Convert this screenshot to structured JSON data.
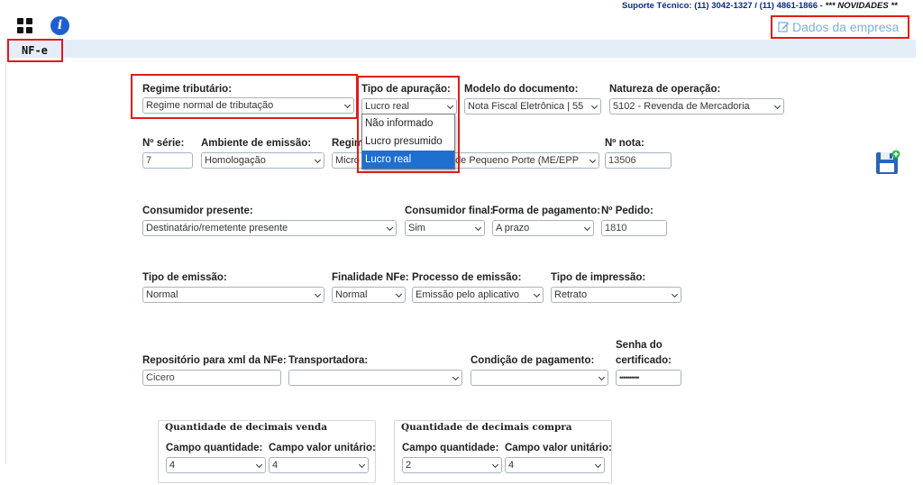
{
  "header": {
    "support_text": "Suporte Técnico: (11) 3042-1327 / (11) 4861-1866 - ",
    "novidades_text": "*** NOVIDADES **",
    "dados_empresa_label": "Dados da empresa",
    "section_title": "NF-e"
  },
  "form": {
    "regime_tributario": {
      "label": "Regime tributário:",
      "value": "Regime normal de tributação"
    },
    "tipo_apuracao": {
      "label": "Tipo de apuração:",
      "value": "Lucro real",
      "options": [
        "Não informado",
        "Lucro presumido",
        "Lucro real"
      ]
    },
    "modelo_documento": {
      "label": "Modelo do documento:",
      "value": "Nota Fiscal Eletrônica | 55"
    },
    "natureza_operacao": {
      "label": "Natureza de operação:",
      "value": "5102 - Revenda de Mercadoria"
    },
    "n_serie": {
      "label": "Nº série:",
      "value": "7"
    },
    "ambiente_emissao": {
      "label": "Ambiente de emissão:",
      "value": "Homologação"
    },
    "regime_label_partial": "Regim",
    "regime_select_partial_left": "Micro",
    "regime_select_partial_right": "a de Pequeno Porte (ME/EPP",
    "n_nota": {
      "label": "Nº nota:",
      "value": "13506"
    },
    "consumidor_presente": {
      "label": "Consumidor presente:",
      "value": "Destinatário/remetente presente"
    },
    "consumidor_final": {
      "label": "Consumidor final:",
      "value": "Sim"
    },
    "forma_pagamento": {
      "label": "Forma de pagamento:",
      "value": "A prazo"
    },
    "n_pedido": {
      "label": "Nº Pedido:",
      "value": "1810"
    },
    "tipo_emissao": {
      "label": "Tipo de emissão:",
      "value": "Normal"
    },
    "finalidade_nfe": {
      "label": "Finalidade NFe:",
      "value": "Normal"
    },
    "processo_emissao": {
      "label": "Processo de emissão:",
      "value": "Emissão pelo aplicativo"
    },
    "tipo_impressao": {
      "label": "Tipo de impressão:",
      "value": "Retrato"
    },
    "repositorio_xml": {
      "label": "Repositório para xml da NFe:",
      "value": "Cicero"
    },
    "transportadora": {
      "label": "Transportadora:",
      "value": ""
    },
    "condicao_pagamento": {
      "label": "Condição de pagamento:",
      "value": ""
    },
    "senha_certificado": {
      "label_line1": "Senha do",
      "label_line2": "certificado:",
      "value": "••••••••••"
    }
  },
  "decimais_venda": {
    "legend": "Quantidade de decimais venda",
    "campo_quantidade": {
      "label": "Campo quantidade:",
      "value": "4"
    },
    "campo_valor_unitario": {
      "label": "Campo valor unitário:",
      "value": "4"
    }
  },
  "decimais_compra": {
    "legend": "Quantidade de decimais compra",
    "campo_quantidade": {
      "label": "Campo quantidade:",
      "value": "2"
    },
    "campo_valor_unitario": {
      "label": "Campo valor unitário:",
      "value": "4"
    }
  },
  "icons": {
    "grid": "apps-grid-icon",
    "info": "info-icon",
    "edit": "edit-icon",
    "save": "save-floppy-icon"
  },
  "colors": {
    "highlight_red": "#e01b1b",
    "header_bar": "#e3eef8",
    "dropdown_selected": "#1e6fd0",
    "support_text": "#0a2a8a"
  }
}
